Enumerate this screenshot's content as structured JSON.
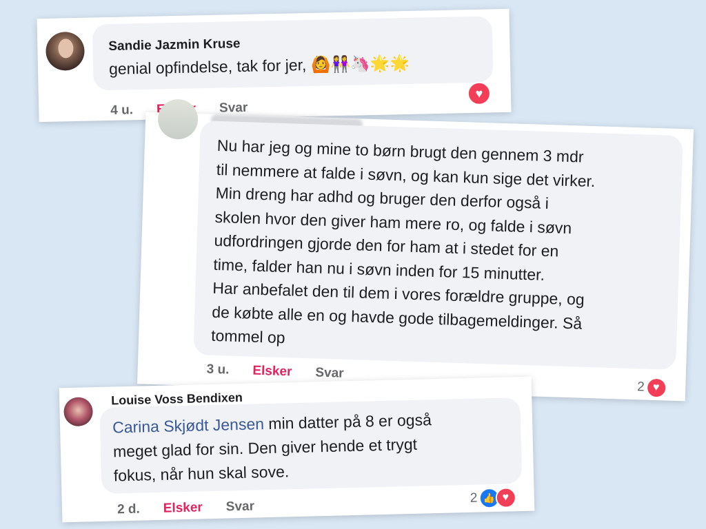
{
  "comments": [
    {
      "author": "Sandie Jazmin Kruse",
      "text": "genial opfindelse, tak for jer,",
      "emojis": "🙆👭🦄🌟🌟",
      "time": "4 u.",
      "love_action": "Elsker",
      "reply_action": "Svar",
      "reaction_icons": [
        "heart-icon"
      ]
    },
    {
      "author": "",
      "text_lines": [
        "Nu har jeg og mine to børn brugt den gennem 3 mdr",
        "til nemmere at falde i søvn, og kan kun sige det virker.",
        "Min dreng har adhd og bruger den derfor også i",
        "skolen hvor den giver ham mere ro, og falde i søvn",
        "udfordringen gjorde den for ham at i stedet for en",
        "time, falder han nu i søvn inden for 15 minutter.",
        "Har anbefalet den til dem i vores forældre gruppe, og",
        "de købte alle en og havde gode tilbagemeldinger. Så",
        "tommel op"
      ],
      "time": "3 u.",
      "love_action": "Elsker",
      "reply_action": "Svar",
      "reaction_count": "2",
      "reaction_icons": [
        "heart-icon"
      ]
    },
    {
      "author": "Louise Voss Bendixen",
      "mention": "Carina Skjødt Jensen",
      "text_lines": [
        "min datter på 8 er også",
        "meget glad for sin. Den giver hende et trygt",
        "fokus, når hun skal sove."
      ],
      "time": "2 d.",
      "love_action": "Elsker",
      "reply_action": "Svar",
      "reaction_count": "2",
      "reaction_icons": [
        "like-icon",
        "heart-icon"
      ]
    }
  ],
  "colors": {
    "background": "#d9e7f5",
    "bubble": "#f0f2f5",
    "love": "#e0245e",
    "mention": "#385898",
    "heart": "#f33e58",
    "like": "#1877f2"
  }
}
